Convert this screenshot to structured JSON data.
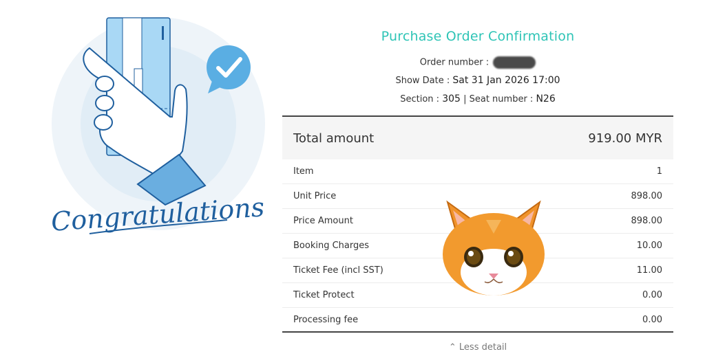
{
  "illustration": {
    "caption": "Congratulations"
  },
  "order": {
    "title": "Purchase Order Confirmation",
    "order_number_label": "Order number :",
    "show_date_label": "Show Date :",
    "show_date_value": "Sat 31 Jan 2026 17:00",
    "section_label": "Section :",
    "section_value": "305",
    "seat_separator": "|",
    "seat_label": "Seat number :",
    "seat_value": "N26"
  },
  "summary": {
    "label": "Total amount",
    "value": "919.00 MYR"
  },
  "rows": [
    {
      "label": "Item",
      "value": "1"
    },
    {
      "label": "Unit Price",
      "value": "898.00"
    },
    {
      "label": "Price Amount",
      "value": "898.00"
    },
    {
      "label": "Booking Charges",
      "value": "10.00"
    },
    {
      "label": "Ticket Fee (incl SST)",
      "value": "11.00"
    },
    {
      "label": "Ticket Protect",
      "value": "0.00"
    },
    {
      "label": "Processing fee",
      "value": "0.00"
    }
  ],
  "toggle": {
    "icon": "chevron-up-icon",
    "label": "Less detail"
  },
  "colors": {
    "accent": "#2ec4b6",
    "illustration_blue": "#1f5f9e",
    "light_blue": "#a9d8f5"
  }
}
